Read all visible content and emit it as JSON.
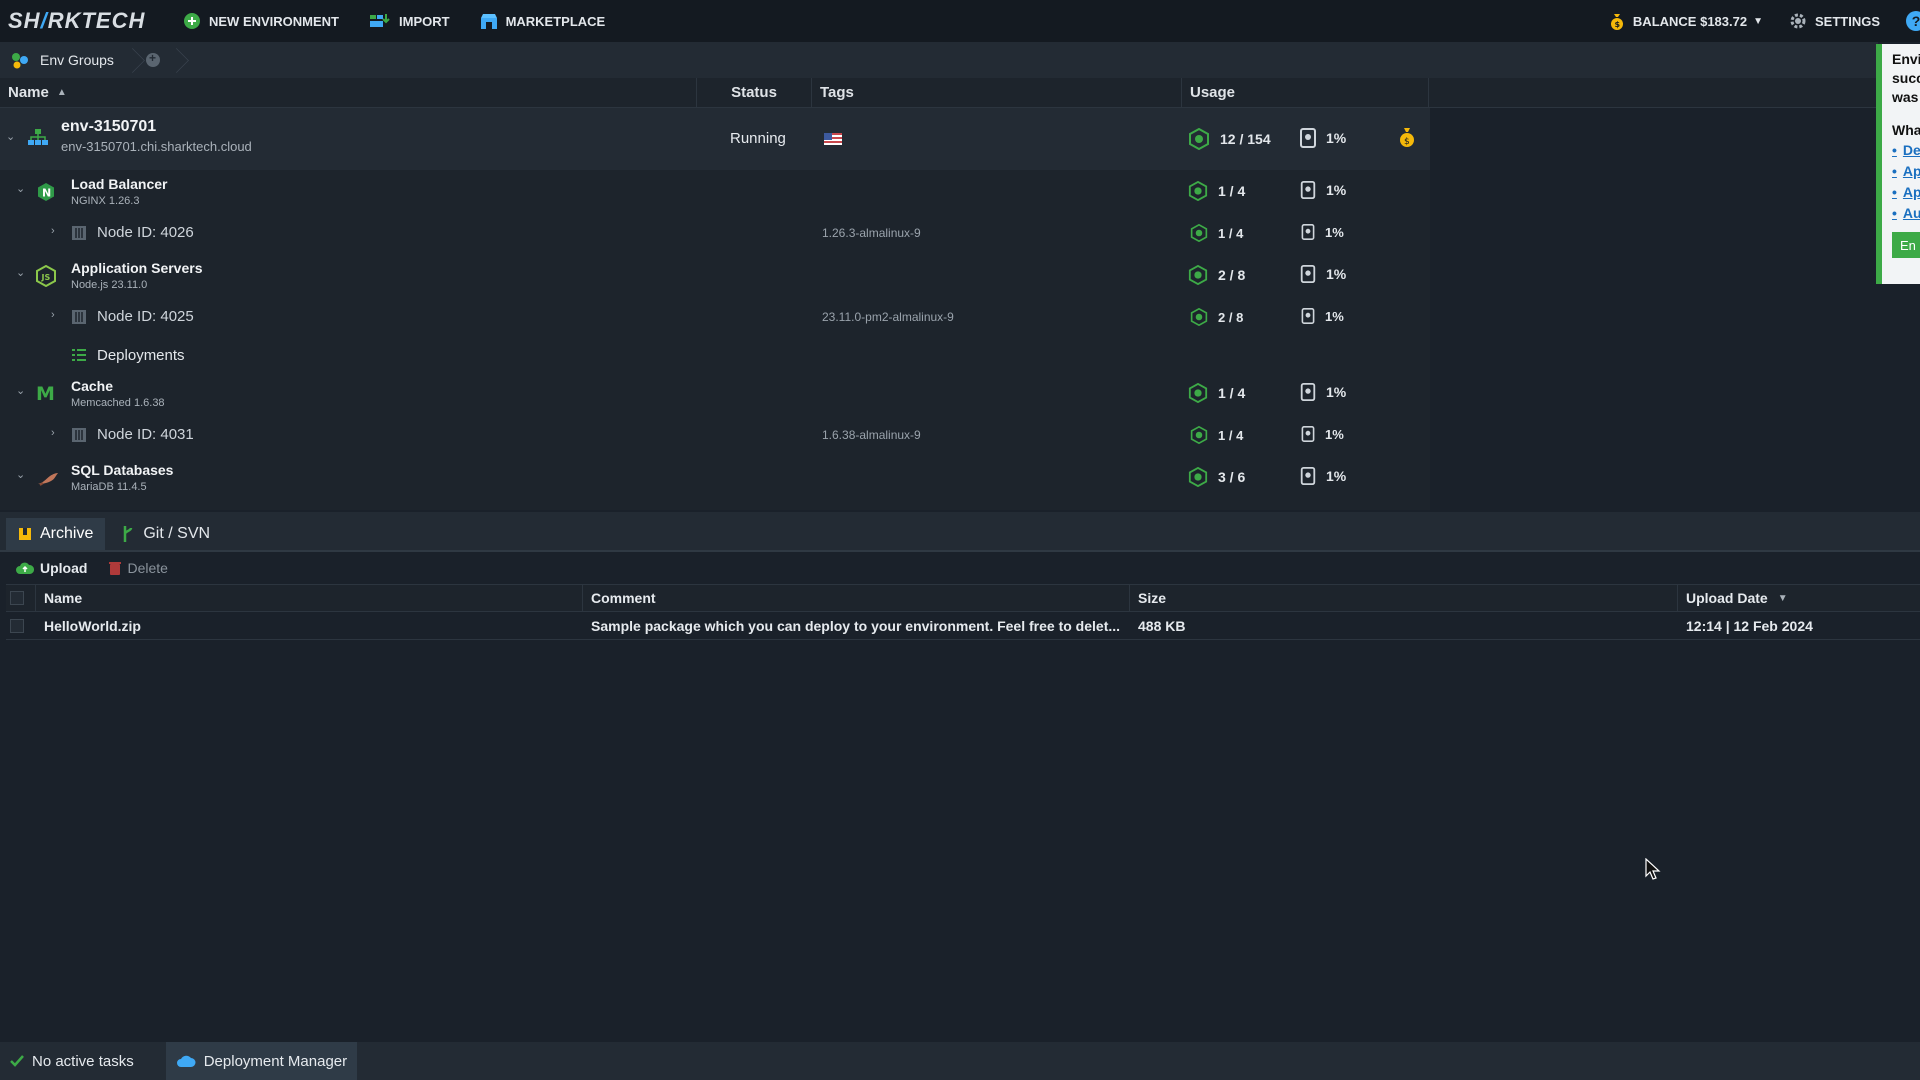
{
  "topbar": {
    "logo_left": "SH",
    "logo_slash": "/",
    "logo_right": "RKTECH",
    "new_environment": "NEW ENVIRONMENT",
    "import": "IMPORT",
    "marketplace": "MARKETPLACE",
    "balance": "BALANCE $183.72",
    "settings": "SETTINGS",
    "help": "?"
  },
  "breadcrumb": {
    "env_groups": "Env Groups"
  },
  "grid": {
    "headers": {
      "name": "Name",
      "status": "Status",
      "tags": "Tags",
      "usage": "Usage"
    },
    "env": {
      "name": "env-3150701",
      "domain": "env-3150701.chi.sharktech.cloud",
      "status": "Running",
      "usage": "12 / 154",
      "disk": "1%"
    },
    "groups": [
      {
        "title": "Load Balancer",
        "subtitle": "NGINX 1.26.3",
        "usage": "1 / 4",
        "disk": "1%",
        "icon": "nginx-icon",
        "node": {
          "label": "Node ID: 4026",
          "tag": "1.26.3-almalinux-9",
          "usage": "1 / 4",
          "disk": "1%"
        }
      },
      {
        "title": "Application Servers",
        "subtitle": "Node.js 23.11.0",
        "usage": "2 / 8",
        "disk": "1%",
        "icon": "nodejs-icon",
        "node": {
          "label": "Node ID: 4025",
          "tag": "23.11.0-pm2-almalinux-9",
          "usage": "2 / 8",
          "disk": "1%"
        },
        "extra": "Deployments"
      },
      {
        "title": "Cache",
        "subtitle": "Memcached 1.6.38",
        "usage": "1 / 4",
        "disk": "1%",
        "icon": "memcached-icon",
        "node": {
          "label": "Node ID: 4031",
          "tag": "1.6.38-almalinux-9",
          "usage": "1 / 4",
          "disk": "1%"
        }
      },
      {
        "title": "SQL Databases",
        "subtitle": "MariaDB 11.4.5",
        "usage": "3 / 6",
        "disk": "1%",
        "icon": "mariadb-icon"
      }
    ]
  },
  "deployment_manager": {
    "tabs": [
      "Archive",
      "Git / SVN"
    ],
    "toolbar": {
      "upload": "Upload",
      "delete": "Delete"
    },
    "headers": {
      "name": "Name",
      "comment": "Comment",
      "size": "Size",
      "date": "Upload Date"
    },
    "rows": [
      {
        "name": "HelloWorld.zip",
        "comment": "Sample package which you can deploy to your environment. Feel free to delet...",
        "size": "488 KB",
        "date": "12:14 | 12 Feb 2024"
      }
    ]
  },
  "statusbar": {
    "tasks": "No active tasks",
    "deployment_manager": "Deployment Manager"
  },
  "notification": {
    "lines": [
      "Envi",
      "succ",
      "was"
    ],
    "heading": "Wha",
    "links": [
      "De",
      "Ap",
      "Ap",
      "Au"
    ],
    "button": "En"
  },
  "colors": {
    "accent": "#3fa9f5",
    "success": "#3daa47",
    "background": "#1a212a"
  }
}
